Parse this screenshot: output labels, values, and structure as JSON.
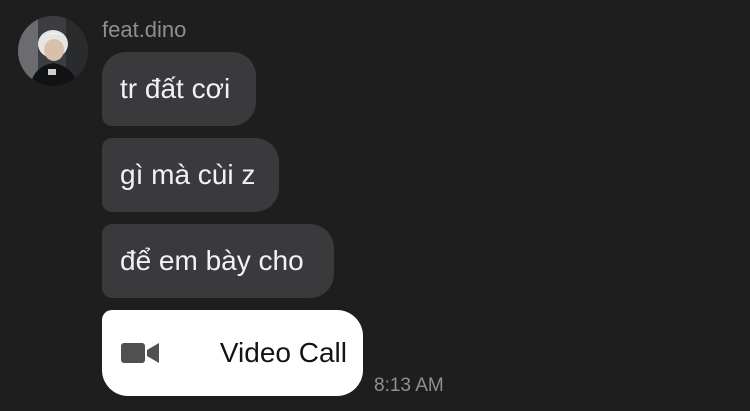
{
  "sender": {
    "name": "feat.dino",
    "avatar_icon": "profile-photo"
  },
  "messages": [
    {
      "text": "tr đất cơi"
    },
    {
      "text": "gì mà cùi z"
    },
    {
      "text": "để em bày cho"
    }
  ],
  "call": {
    "label": "Video Call",
    "icon": "video-camera-icon",
    "timestamp": "8:13 AM"
  },
  "colors": {
    "background": "#1e1e1f",
    "bubble": "#3a3a3c",
    "bubble_text": "#f2f2f4",
    "call_bubble": "#ffffff",
    "muted_text": "#8f8f93"
  }
}
